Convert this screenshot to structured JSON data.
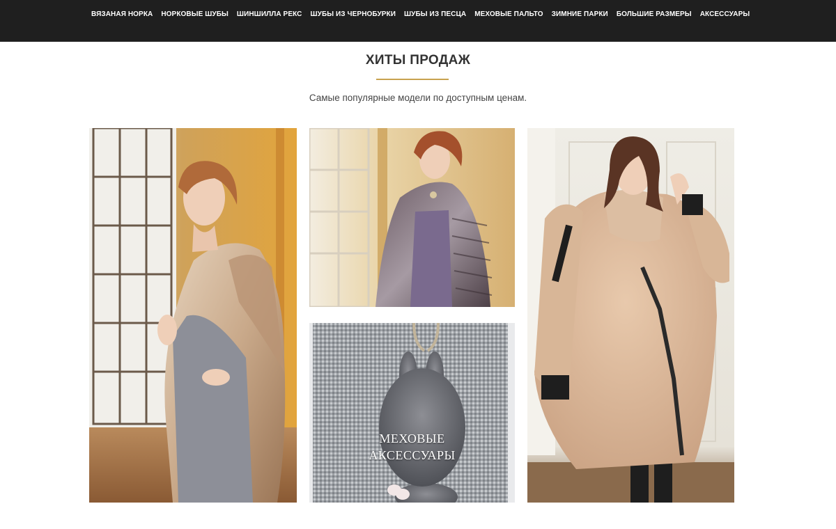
{
  "nav": {
    "items": [
      "Вязаная норка",
      "Норковые шубы",
      "Шиншилла рекс",
      "Шубы из чернобурки",
      "Шубы из песца",
      "Меховые пальто",
      "Зимние парки",
      "Большие размеры",
      "Аксессуары"
    ]
  },
  "section": {
    "title": "ХИТЫ ПРОДАЖ",
    "subtitle": "Самые популярные модели по доступным ценам."
  },
  "tiles": {
    "accessories": {
      "line1": "МЕХОВЫЕ",
      "line2": "АКСЕССУАРЫ"
    }
  },
  "colors": {
    "nav_bg": "#1f1f1f",
    "accent_rule": "#c8a24e"
  }
}
